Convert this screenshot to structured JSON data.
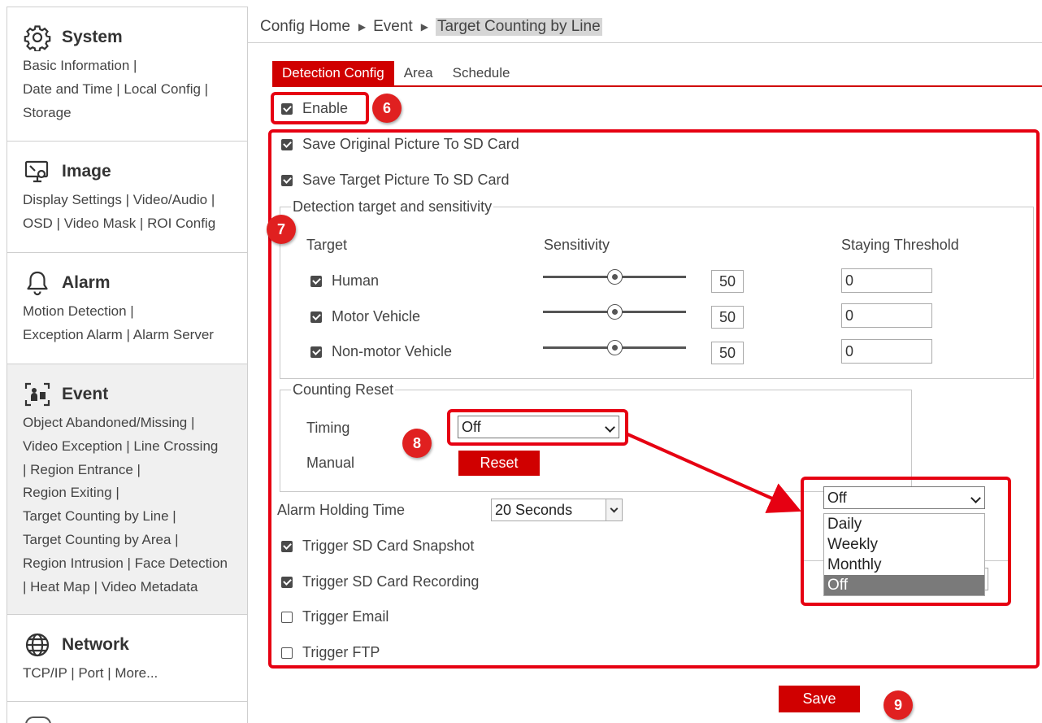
{
  "sidebar": {
    "system": {
      "title": "System",
      "links": [
        "Basic Information |",
        "Date and Time | Local Config |",
        "Storage"
      ]
    },
    "image": {
      "title": "Image",
      "links": [
        "Display Settings | Video/Audio |",
        "OSD | Video Mask | ROI Config"
      ]
    },
    "alarm": {
      "title": "Alarm",
      "links": [
        "Motion Detection |",
        "Exception Alarm | Alarm Server"
      ]
    },
    "event": {
      "title": "Event",
      "links": [
        "Object Abandoned/Missing |",
        "Video Exception | Line Crossing",
        " | Region Entrance |",
        "Region Exiting |",
        "Target Counting by Line |",
        "Target Counting by Area |",
        "Region Intrusion | Face Detection",
        " | Heat Map | Video Metadata"
      ]
    },
    "network": {
      "title": "Network",
      "links": [
        "TCP/IP | Port | More..."
      ]
    }
  },
  "breadcrumb": {
    "home": "Config Home",
    "section": "Event",
    "current": "Target Counting by Line"
  },
  "tabs": [
    "Detection Config",
    "Area",
    "Schedule"
  ],
  "enable_label": "Enable",
  "save_original_label": "Save Original Picture To SD Card",
  "save_target_label": "Save Target Picture To SD Card",
  "detection": {
    "legend": "Detection target and sensitivity",
    "col_target": "Target",
    "col_sensitivity": "Sensitivity",
    "col_threshold": "Staying Threshold",
    "rows": [
      {
        "label": "Human",
        "sensitivity": "50",
        "threshold": "0"
      },
      {
        "label": "Motor Vehicle",
        "sensitivity": "50",
        "threshold": "0"
      },
      {
        "label": "Non-motor Vehicle",
        "sensitivity": "50",
        "threshold": "0"
      }
    ],
    "sensitivity_fraction": 0.5
  },
  "counting_reset": {
    "legend": "Counting Reset",
    "timing_label": "Timing",
    "timing_value": "Off",
    "manual_label": "Manual",
    "reset_button": "Reset"
  },
  "alarm_holding": {
    "label": "Alarm Holding Time",
    "value": "20 Seconds"
  },
  "triggers": {
    "sd_snapshot": "Trigger SD Card Snapshot",
    "sd_recording": "Trigger SD Card Recording",
    "email": "Trigger Email",
    "ftp": "Trigger FTP"
  },
  "save_button": "Save",
  "dropdown_callout": {
    "value": "Off",
    "options": [
      "Daily",
      "Weekly",
      "Monthly",
      "Off"
    ],
    "selected": "Off"
  },
  "badges": {
    "enable": "6",
    "settings": "7",
    "timing": "8",
    "save": "9"
  },
  "colors": {
    "accent_red": "#d00000",
    "highlight_red": "#e60012",
    "selected_option_gray": "#7a7a7a"
  },
  "icons": {
    "system": "gear-icon",
    "image": "monitor-settings-icon",
    "alarm": "bell-icon",
    "event": "event-person-icon",
    "network": "globe-icon"
  }
}
